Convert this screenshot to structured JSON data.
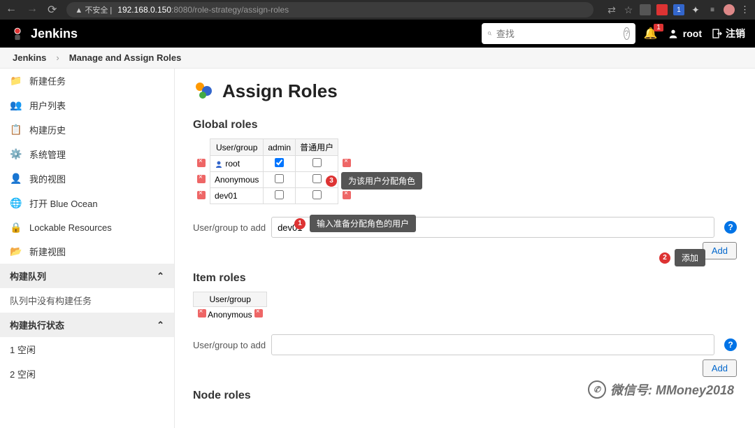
{
  "browser": {
    "security_label": "不安全",
    "host": "192.168.0.150",
    "port": ":8080",
    "path": "/role-strategy/assign-roles"
  },
  "header": {
    "brand": "Jenkins",
    "search_placeholder": "查找",
    "notif_count": "1",
    "username": "root",
    "logout": "注销"
  },
  "crumbs": {
    "home": "Jenkins",
    "page": "Manage and Assign Roles"
  },
  "sidebar": {
    "items": [
      {
        "label": "新建任务"
      },
      {
        "label": "用户列表"
      },
      {
        "label": "构建历史"
      },
      {
        "label": "系统管理"
      },
      {
        "label": "我的视图"
      },
      {
        "label": "打开 Blue Ocean"
      },
      {
        "label": "Lockable Resources"
      },
      {
        "label": "新建视图"
      }
    ],
    "queue_header": "构建队列",
    "queue_empty": "队列中没有构建任务",
    "exec_header": "构建执行状态",
    "exec1": "1  空闲",
    "exec2": "2  空闲"
  },
  "main": {
    "title": "Assign Roles",
    "global_roles_heading": "Global roles",
    "item_roles_heading": "Item roles",
    "node_roles_heading": "Node roles",
    "th_usergroup": "User/group",
    "th_admin": "admin",
    "th_common": "普通用户",
    "rows": [
      {
        "name": "root",
        "admin": true,
        "common": false
      },
      {
        "name": "Anonymous",
        "admin": false,
        "common": false
      },
      {
        "name": "dev01",
        "admin": false,
        "common": false
      }
    ],
    "item_rows": [
      {
        "name": "Anonymous"
      }
    ],
    "add_label": "User/group to add",
    "add_value": "dev01",
    "add_button": "Add"
  },
  "callouts": {
    "c1_num": "1",
    "c1_tip": "输入准备分配角色的用户",
    "c2_num": "2",
    "c2_tip": "添加",
    "c3_num": "3",
    "c3_tip": "为该用户分配角色"
  },
  "watermark": "微信号: MMoney2018"
}
